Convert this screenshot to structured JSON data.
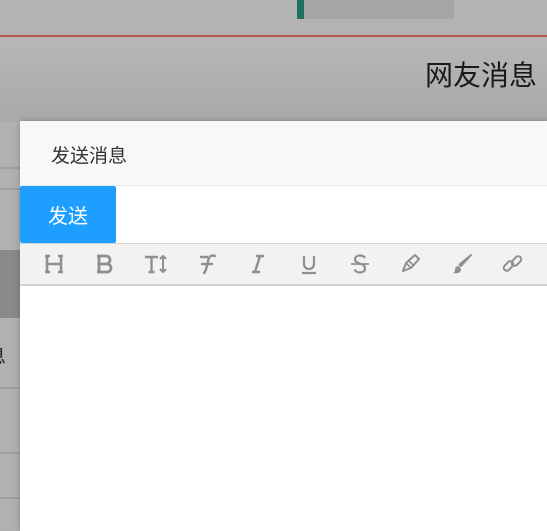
{
  "background": {
    "header_title": "网友消息",
    "left_fragment": "息"
  },
  "dialog": {
    "title": "发送消息",
    "send_label": "发送"
  },
  "toolbar": {
    "tools": [
      {
        "name": "heading-icon",
        "glyph": "H"
      },
      {
        "name": "bold-icon",
        "glyph": "B"
      },
      {
        "name": "font-size-icon",
        "glyph": "T↕"
      },
      {
        "name": "font-family-icon",
        "glyph": "F"
      },
      {
        "name": "italic-icon",
        "glyph": "I"
      },
      {
        "name": "underline-icon",
        "glyph": "U"
      },
      {
        "name": "strikethrough-icon",
        "glyph": "S"
      },
      {
        "name": "highlighter-icon",
        "glyph": "pen"
      },
      {
        "name": "brush-icon",
        "glyph": "brush"
      },
      {
        "name": "link-icon",
        "glyph": "link"
      }
    ]
  },
  "colors": {
    "primary": "#1e9fff",
    "icon": "#8f8f8f",
    "accent_bar": "#1e6e61",
    "red_line": "#b75a45"
  }
}
